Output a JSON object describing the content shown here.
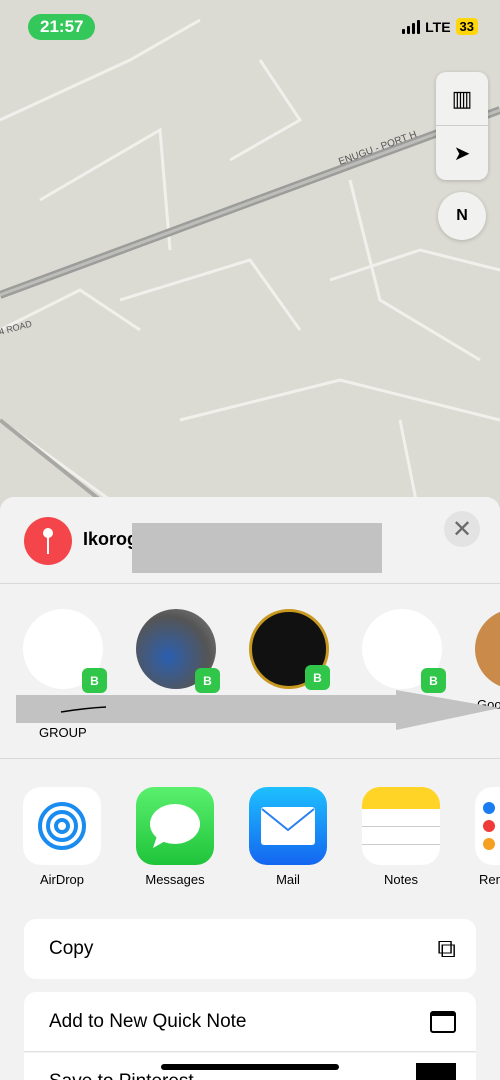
{
  "status": {
    "time": "21:57",
    "network": "LTE",
    "battery": "33"
  },
  "map": {
    "road_labels": [
      "ENUGU - PORT H",
      "4 ROAD"
    ],
    "compass": "N"
  },
  "sheet": {
    "title": "Ikorog",
    "close_icon": "close-icon",
    "people": [
      {
        "name": "",
        "badge": "B"
      },
      {
        "name": "",
        "badge": "B"
      },
      {
        "name": "",
        "badge": "B"
      },
      {
        "name": "",
        "badge": "B"
      },
      {
        "name": "Goo"
      }
    ],
    "group_label": "GROUP",
    "apps": [
      {
        "label": "AirDrop"
      },
      {
        "label": "Messages"
      },
      {
        "label": "Mail"
      },
      {
        "label": "Notes"
      },
      {
        "label": "Rem"
      }
    ],
    "actions": [
      {
        "label": "Copy",
        "icon": "copy-icon"
      },
      {
        "label": "Add to New Quick Note",
        "icon": "quick-note-icon"
      },
      {
        "label": "Save to Pinterest",
        "icon": "pinterest-icon"
      }
    ]
  },
  "colors": {
    "pin": "#f4454a",
    "whatsapp": "#2fc64a",
    "time_pill": "#34c759"
  }
}
